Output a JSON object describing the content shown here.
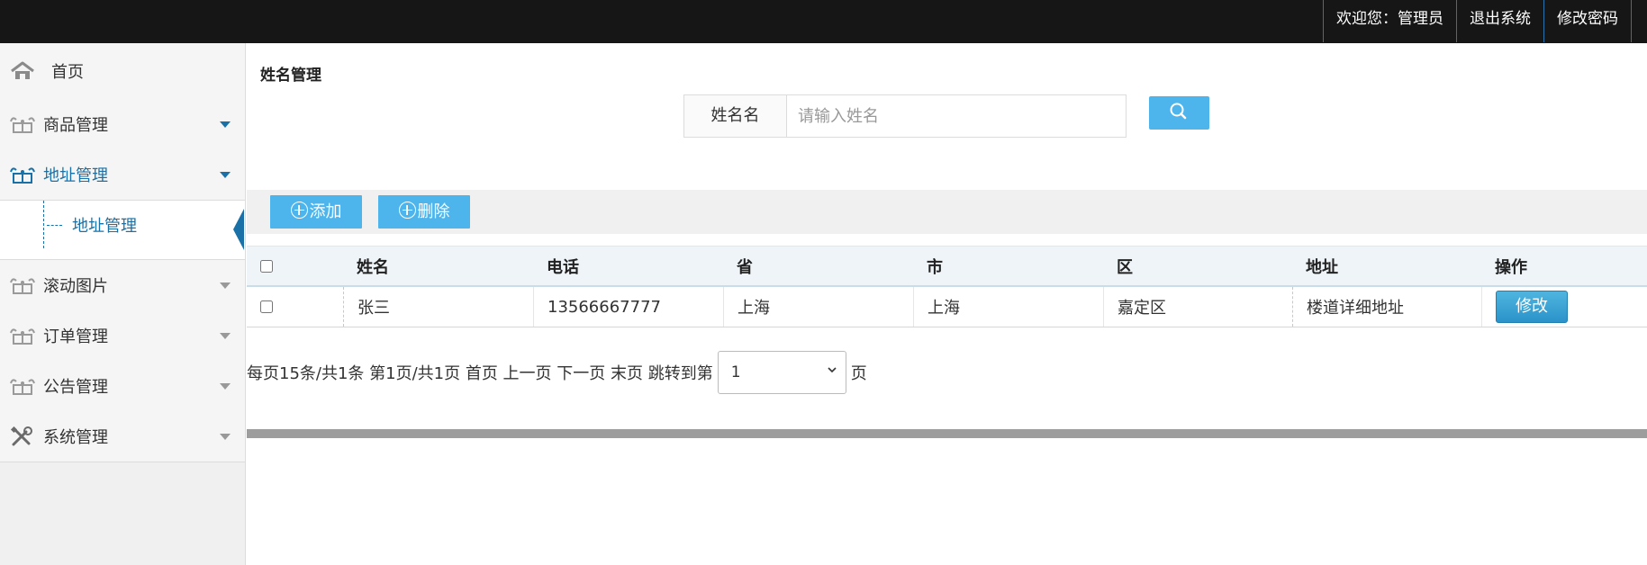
{
  "topbar": {
    "welcome": "欢迎您：管理员",
    "logout": "退出系统",
    "change_password": "修改密码"
  },
  "sidebar": {
    "home": "首页",
    "items": [
      {
        "label": "商品管理",
        "icon": "gift-icon"
      },
      {
        "label": "地址管理",
        "icon": "gift-icon",
        "active": true
      },
      {
        "label": "滚动图片",
        "icon": "gift-icon"
      },
      {
        "label": "订单管理",
        "icon": "gift-icon"
      },
      {
        "label": "公告管理",
        "icon": "gift-icon"
      },
      {
        "label": "系统管理",
        "icon": "tools-icon"
      }
    ],
    "sub_item": "地址管理"
  },
  "main": {
    "title": "姓名管理",
    "search": {
      "label": "姓名名",
      "placeholder": "请输入姓名"
    },
    "toolbar": {
      "add": "添加",
      "delete": "删除"
    },
    "table": {
      "columns": [
        "姓名",
        "电话",
        "省",
        "市",
        "区",
        "地址",
        "操作"
      ],
      "rows": [
        {
          "name": "张三",
          "phone": "13566667777",
          "province": "上海",
          "city": "上海",
          "district": "嘉定区",
          "address": "楼道详细地址",
          "action": "修改"
        }
      ]
    },
    "pager": {
      "summary": "每页15条/共1条 第1页/共1页 首页 上一页 下一页 末页 跳转到第",
      "page_value": "1",
      "suffix": "页"
    }
  },
  "colors": {
    "topbar": "#161616",
    "accent": "#4db5ec",
    "active_link": "#1a71a8"
  }
}
